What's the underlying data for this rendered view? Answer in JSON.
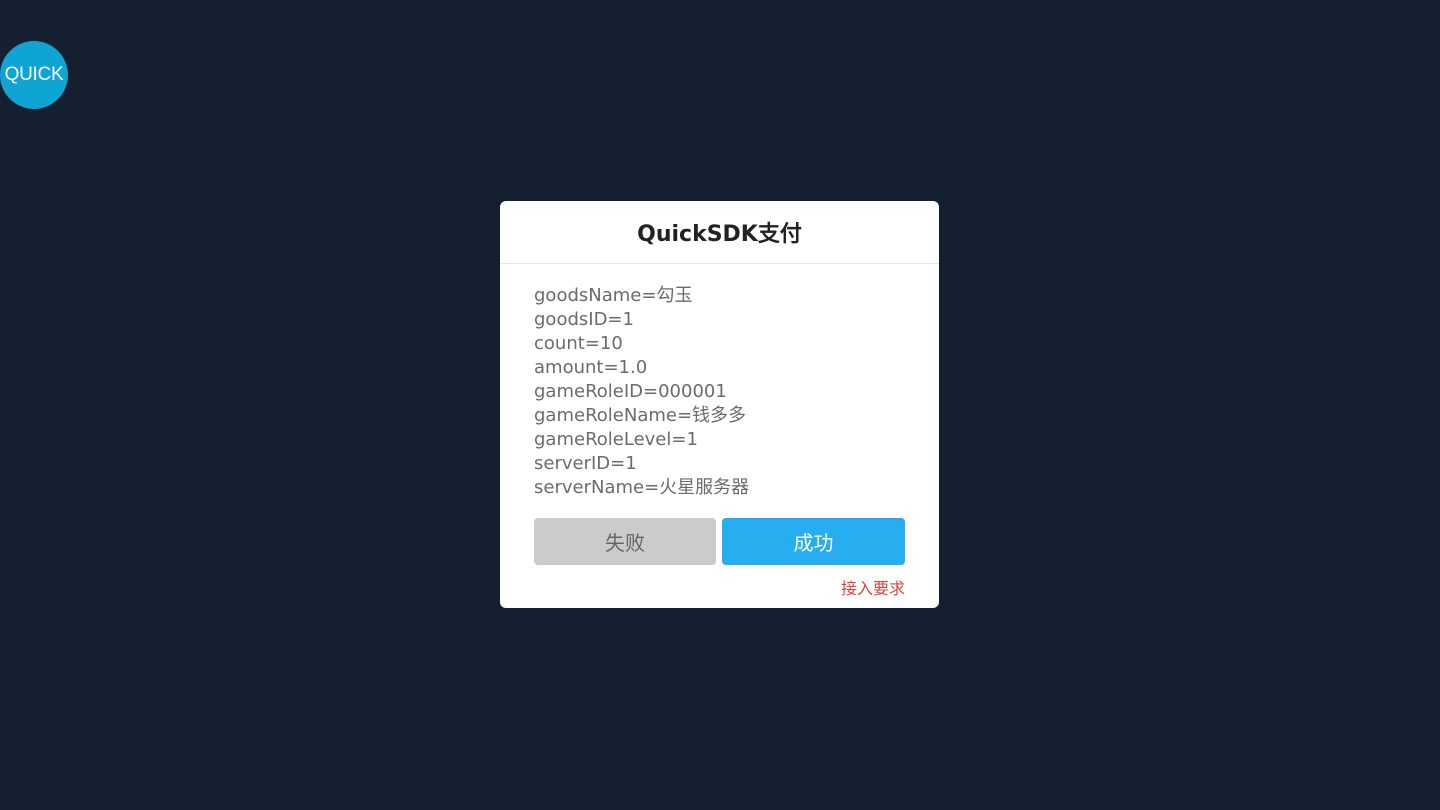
{
  "floating_button": {
    "label": "QUICK",
    "color": "#0ea5d2"
  },
  "dialog": {
    "title": "QuickSDK支付",
    "lines": [
      "goodsName=勾玉",
      "goodsID=1",
      "count=10",
      "amount=1.0",
      "gameRoleID=000001",
      "gameRoleName=钱多多",
      "gameRoleLevel=1",
      "serverID=1",
      "serverName=火星服务器"
    ],
    "fail_label": "失败",
    "success_label": "成功",
    "requirements_link": "接入要求"
  },
  "colors": {
    "background": "#141f30",
    "success": "#27aef0",
    "fail": "#cbcbcb",
    "link": "#d64541"
  }
}
